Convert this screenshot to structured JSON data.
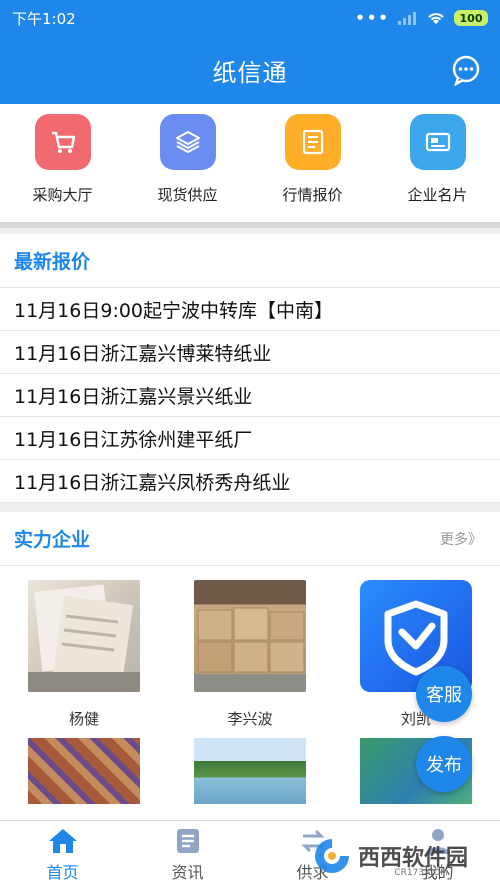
{
  "status_bar": {
    "time": "下午1:02",
    "battery": "100"
  },
  "header": {
    "title": "纸信通",
    "chat_icon": "chat-bubble-icon"
  },
  "quick_actions": [
    {
      "label": "采购大厅",
      "icon": "cart-icon",
      "color": "#f06a6f"
    },
    {
      "label": "现货供应",
      "icon": "layers-icon",
      "color": "#6b8cf0"
    },
    {
      "label": "行情报价",
      "icon": "document-icon",
      "color": "#ffae2a"
    },
    {
      "label": "企业名片",
      "icon": "card-icon",
      "color": "#3ca7ea"
    }
  ],
  "latest_quotes": {
    "title": "最新报价",
    "items": [
      "11月16日9:00起宁波中转库【中南】",
      "11月16日浙江嘉兴博莱特纸业",
      "11月16日浙江嘉兴景兴纸业",
      "11月16日江苏徐州建平纸厂",
      "11月16日浙江嘉兴凤桥秀舟纸业"
    ]
  },
  "companies": {
    "title": "实力企业",
    "more": "更多》",
    "items": [
      {
        "name": "杨健"
      },
      {
        "name": "李兴波"
      },
      {
        "name": "刘凯"
      }
    ]
  },
  "float_buttons": {
    "service": "客服",
    "publish": "发布"
  },
  "tabs": [
    {
      "label": "首页",
      "icon": "home-icon",
      "active": true
    },
    {
      "label": "资讯",
      "icon": "news-icon",
      "active": false
    },
    {
      "label": "供求",
      "icon": "swap-icon",
      "active": false
    },
    {
      "label": "我的",
      "icon": "user-icon",
      "active": false
    }
  ],
  "watermark": {
    "text": "西西软件园",
    "sub": "CR173.COM"
  },
  "colors": {
    "primary": "#1f86ea"
  }
}
